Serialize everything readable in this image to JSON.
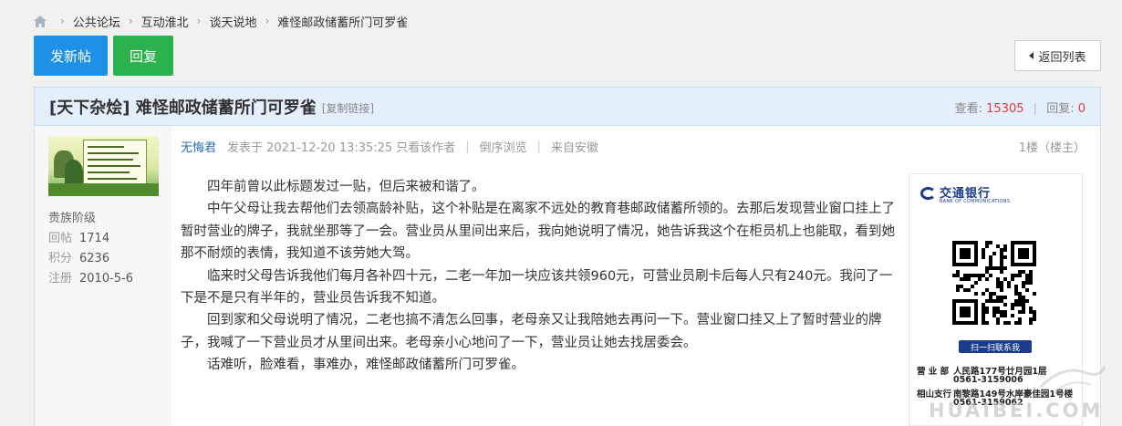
{
  "breadcrumb": {
    "items": [
      "公共论坛",
      "互动淮北",
      "谈天说地",
      "难怪邮政储蓄所门可罗雀"
    ]
  },
  "toolbar": {
    "new_post": "发新帖",
    "reply": "回复",
    "back": "返回列表"
  },
  "thread": {
    "title": "[天下杂烩] 难怪邮政储蓄所门可罗雀",
    "copy_link": "[复制链接]",
    "views_label": "查看:",
    "views": "15305",
    "replies_label": "回复:",
    "replies": "0"
  },
  "author": {
    "rank": "贵族阶级",
    "posts_label": "回帖",
    "posts": "1714",
    "points_label": "积分",
    "points": "6236",
    "reg_label": "注册",
    "reg": "2010-5-6"
  },
  "post": {
    "author": "无悔君",
    "posted": "发表于 2021-12-20 13:35:25",
    "only_author": "只看该作者",
    "reverse": "倒序浏览",
    "source": "来自安徽",
    "floor": "1楼（楼主）",
    "paragraphs": [
      "四年前曾以此标题发过一贴，但后来被和谐了。",
      "中午父母让我去帮他们去领高龄补贴，这个补贴是在离家不远处的教育巷邮政储蓄所领的。去那后发现营业窗口挂上了暂时营业的牌子，我就坐那等了一会。营业员从里间出来后，我向她说明了情况，她告诉我这个在柜员机上也能取，看到她那不耐烦的表情，我知道不该劳她大驾。",
      "临来时父母告诉我他们每月各补四十元，二老一年加一块应该共领960元，可营业员刷卡后每人只有240元。我问了一下是不是只有半年的，营业员告诉我不知道。",
      "回到家和父母说明了情况，二老也搞不清怎么回事，老母亲又让我陪她去再问一下。营业窗口挂又上了暂时营业的牌子，我喊了一下营业员才从里间出来。老母亲小心地问了一下，营业员让她去找居委会。",
      "话难听，脸难看，事难办，难怪邮政储蓄所门可罗雀。"
    ]
  },
  "ad": {
    "bank_name": "交通银行",
    "bank_en": "BANK OF COMMUNICATIONS",
    "scan": "扫一扫联系我",
    "line1_label": "营 业 部",
    "line1": "人民路177号廿月园1层",
    "line1_phone": "0561-3159006",
    "line2_label": "相山支行",
    "line2": "南黎路149号水岸豪佳园1号楼",
    "line2_phone": "0561-3159062",
    "brand_color": "#1a3c8a"
  },
  "watermark": "HUAIBEI.COM"
}
